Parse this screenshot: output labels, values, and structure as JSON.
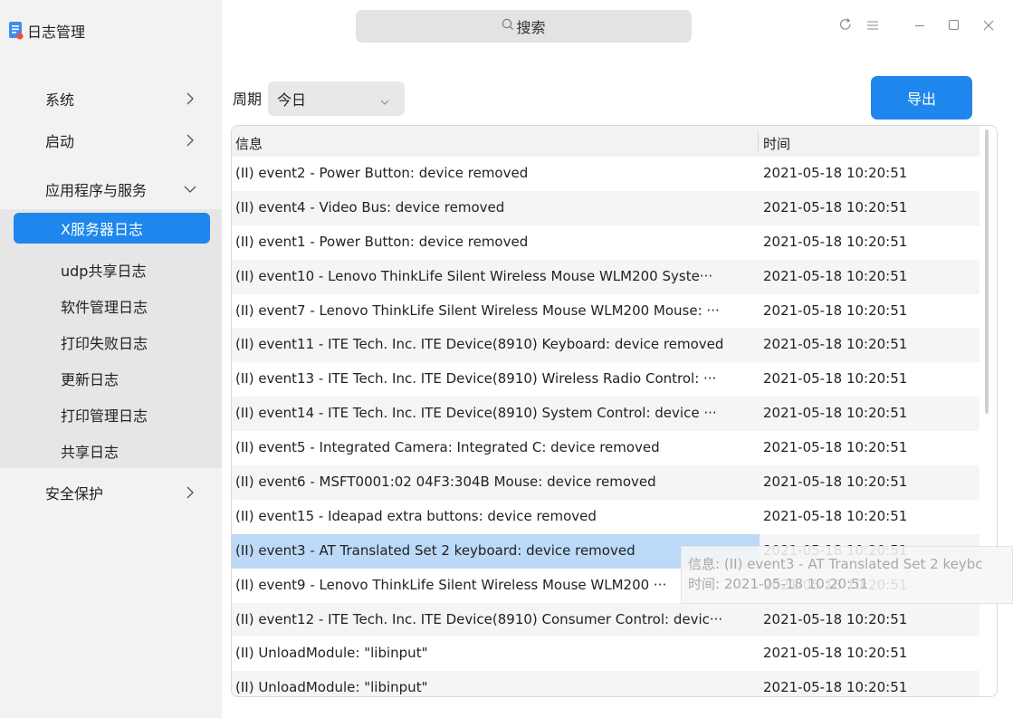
{
  "app": {
    "title": "日志管理",
    "icon": "log-app-icon"
  },
  "titlebar": {
    "search_label": "搜索",
    "buttons": [
      "refresh-icon",
      "menu-icon",
      "minimize-icon",
      "maximize-icon",
      "close-icon"
    ]
  },
  "sidebar": {
    "items": [
      {
        "label": "系统",
        "chevron": "right"
      },
      {
        "label": "启动",
        "chevron": "right"
      },
      {
        "label": "应用程序与服务",
        "chevron": "down"
      },
      {
        "label": "安全保护",
        "chevron": "right"
      }
    ],
    "subitems": [
      {
        "label": "X服务器日志",
        "active": true
      },
      {
        "label": "udp共享日志"
      },
      {
        "label": "软件管理日志"
      },
      {
        "label": "打印失败日志"
      },
      {
        "label": "更新日志"
      },
      {
        "label": "打印管理日志"
      },
      {
        "label": "共享日志"
      }
    ]
  },
  "filter": {
    "period_label": "周期",
    "period_value": "今日",
    "export_label": "导出"
  },
  "table": {
    "headers": {
      "info": "信息",
      "time": "时间"
    },
    "rows": [
      {
        "info": "(II) event2  - Power Button: device removed",
        "time": "2021-05-18 10:20:51"
      },
      {
        "info": "(II) event4  - Video Bus: device removed",
        "time": "2021-05-18 10:20:51"
      },
      {
        "info": "(II) event1  - Power Button: device removed",
        "time": "2021-05-18 10:20:51"
      },
      {
        "info": "(II) event10 - Lenovo ThinkLife Silent Wireless Mouse WLM200 Syste···",
        "time": "2021-05-18 10:20:51"
      },
      {
        "info": "(II) event7  - Lenovo ThinkLife Silent Wireless Mouse WLM200 Mouse: ···",
        "time": "2021-05-18 10:20:51"
      },
      {
        "info": "(II) event11 - ITE Tech. Inc. ITE Device(8910) Keyboard: device removed",
        "time": "2021-05-18 10:20:51"
      },
      {
        "info": "(II) event13 - ITE Tech. Inc. ITE Device(8910) Wireless Radio Control: ···",
        "time": "2021-05-18 10:20:51"
      },
      {
        "info": "(II) event14 - ITE Tech. Inc. ITE Device(8910) System Control: device ···",
        "time": "2021-05-18 10:20:51"
      },
      {
        "info": "(II) event5  - Integrated Camera: Integrated C: device removed",
        "time": "2021-05-18 10:20:51"
      },
      {
        "info": "(II) event6  - MSFT0001:02 04F3:304B Mouse: device removed",
        "time": "2021-05-18 10:20:51"
      },
      {
        "info": "(II) event15 - Ideapad extra buttons: device removed",
        "time": "2021-05-18 10:20:51"
      },
      {
        "info": "(II) event3  - AT Translated Set 2 keyboard: device removed",
        "time": "2021-05-18 10:20:51",
        "selected": true
      },
      {
        "info": "(II) event9  - Lenovo ThinkLife Silent Wireless Mouse WLM200 ···",
        "time": "2021-05-18 10:20:51"
      },
      {
        "info": "(II) event12 - ITE Tech. Inc. ITE Device(8910) Consumer Control: devic···",
        "time": "2021-05-18 10:20:51"
      },
      {
        "info": "(II) UnloadModule: \"libinput\"",
        "time": "2021-05-18 10:20:51"
      },
      {
        "info": "(II) UnloadModule: \"libinput\"",
        "time": "2021-05-18 10:20:51"
      }
    ]
  },
  "tooltip": {
    "line1": "信息: (II) event3  - AT Translated Set 2 keybc",
    "line2": "时间: 2021-05-18 10:20:51"
  },
  "colors": {
    "accent": "#1e86ec",
    "sidebar_bg": "#f2f2f2",
    "selection": "#bcd9f7"
  }
}
